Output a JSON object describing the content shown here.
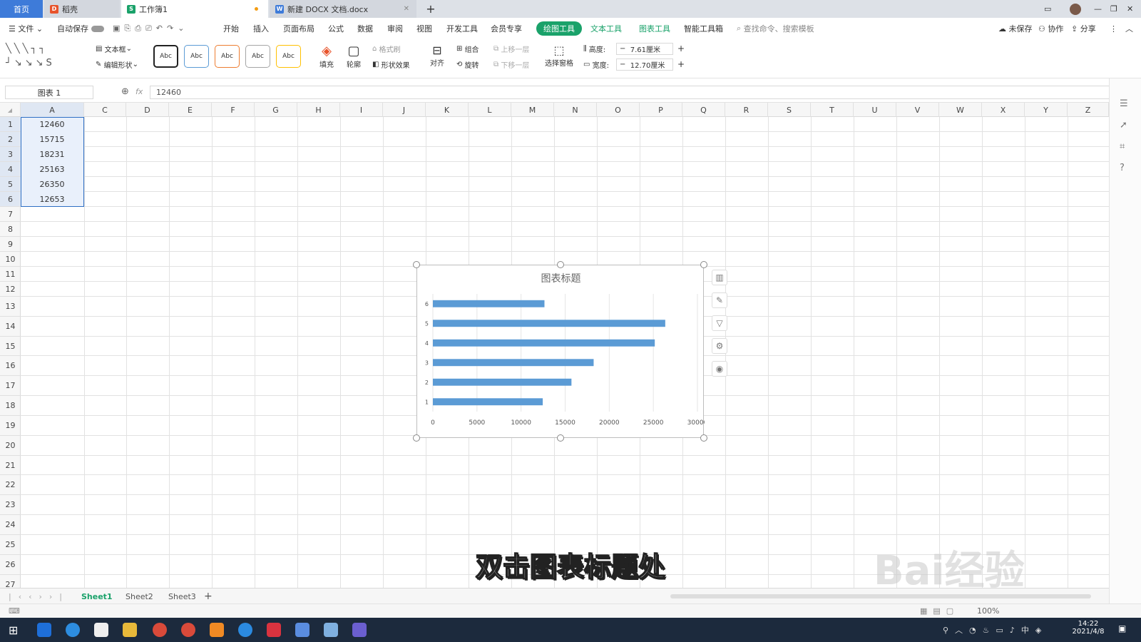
{
  "tabs": {
    "home": "首页",
    "daoke": "稻壳",
    "book": "工作簿1",
    "docx": "新建 DOCX 文档.docx"
  },
  "menu": {
    "file": "文件",
    "autosave": "自动保存",
    "items": [
      "开始",
      "插入",
      "页面布局",
      "公式",
      "数据",
      "审阅",
      "视图",
      "开发工具",
      "会员专享"
    ],
    "drawtools": "绘图工具",
    "texttools": "文本工具",
    "charttools": "图表工具",
    "smart": "智能工具箱",
    "search": "查找命令、搜索模板",
    "unsaved": "未保存",
    "collab": "协作",
    "share": "分享"
  },
  "ribbon": {
    "textbox": "文本框",
    "editshape": "编辑形状",
    "abc": "Abc",
    "fill": "填充",
    "outline": "轮廓",
    "formatbrush": "格式刷",
    "shapefx": "形状效果",
    "align": "对齐",
    "group": "组合",
    "rotate": "旋转",
    "up": "上移一层",
    "down": "下移一层",
    "selectpane": "选择窗格",
    "height_label": "高度:",
    "height_value": "7.61厘米",
    "width_label": "宽度:",
    "width_value": "12.70厘米"
  },
  "formula": {
    "namebox": "图表 1",
    "fx": "fx",
    "value": "12460"
  },
  "columns": [
    "A",
    "C",
    "D",
    "E",
    "F",
    "G",
    "H",
    "I",
    "J",
    "K",
    "L",
    "M",
    "N",
    "O",
    "P",
    "Q",
    "R",
    "S",
    "T",
    "U",
    "V",
    "W",
    "X",
    "Y",
    "Z"
  ],
  "rows": [
    "1",
    "2",
    "3",
    "4",
    "5",
    "6",
    "7",
    "8",
    "9",
    "10",
    "11",
    "12",
    "13",
    "14",
    "15",
    "16",
    "17",
    "18",
    "19",
    "20",
    "21",
    "22",
    "23",
    "24",
    "25",
    "26",
    "27"
  ],
  "cells": [
    "12460",
    "15715",
    "18231",
    "25163",
    "26350",
    "12653"
  ],
  "chart_data": {
    "type": "bar",
    "orientation": "horizontal",
    "title": "图表标题",
    "categories": [
      "1",
      "2",
      "3",
      "4",
      "5",
      "6"
    ],
    "values": [
      12460,
      15715,
      18231,
      25163,
      26350,
      12653
    ],
    "xlim": [
      0,
      30000
    ],
    "xticks": [
      "0",
      "5000",
      "10000",
      "15000",
      "20000",
      "25000",
      "30000"
    ],
    "color": "#5b9bd5"
  },
  "sheets": [
    "Sheet1",
    "Sheet2",
    "Sheet3"
  ],
  "subtitle": "双击图表标题处",
  "watermark": "Bai经验",
  "status": {
    "zoom": "100%"
  },
  "clock": {
    "time": "14:22",
    "date": "2021/4/8"
  },
  "colors": {
    "accent": "#1aa26a",
    "tabblue": "#3e7bd9"
  }
}
